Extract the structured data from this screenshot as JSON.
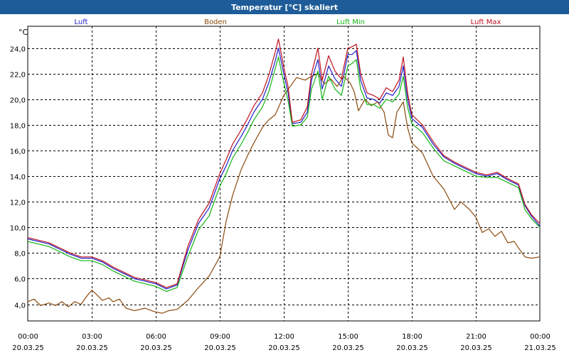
{
  "window": {
    "title": "Temperatur [°C] skaliert"
  },
  "chart_data": {
    "type": "line",
    "ylabel": "°C",
    "ylim": [
      2.7,
      25.7
    ],
    "yticks": [
      4.0,
      6.0,
      8.0,
      10.0,
      12.0,
      14.0,
      16.0,
      18.0,
      20.0,
      22.0,
      24.0
    ],
    "ytick_labels": [
      "4,0",
      "6,0",
      "8,0",
      "10,0",
      "12,0",
      "14,0",
      "16,0",
      "18,0",
      "20,0",
      "22,0",
      "24,0"
    ],
    "xlim": [
      0,
      24
    ],
    "xticks": [
      {
        "x": 0,
        "time": "00:00",
        "date": "20.03.25"
      },
      {
        "x": 3,
        "time": "03:00",
        "date": "20.03.25"
      },
      {
        "x": 6,
        "time": "06:00",
        "date": "20.03.25"
      },
      {
        "x": 9,
        "time": "09:00",
        "date": "20.03.25"
      },
      {
        "x": 12,
        "time": "12:00",
        "date": "20.03.25"
      },
      {
        "x": 15,
        "time": "15:00",
        "date": "20.03.25"
      },
      {
        "x": 18,
        "time": "18:00",
        "date": "20.03.25"
      },
      {
        "x": 21,
        "time": "21:00",
        "date": "20.03.25"
      },
      {
        "x": 24,
        "time": "00:00",
        "date": "21.03.25"
      }
    ],
    "grid": true,
    "legend_position": "top",
    "series": [
      {
        "name": "Luft",
        "color": "#1e1ecc",
        "points": [
          [
            0,
            9.1
          ],
          [
            0.5,
            8.9
          ],
          [
            1,
            8.7
          ],
          [
            1.5,
            8.3
          ],
          [
            2,
            7.9
          ],
          [
            2.5,
            7.6
          ],
          [
            3,
            7.6
          ],
          [
            3.5,
            7.3
          ],
          [
            4,
            6.8
          ],
          [
            4.5,
            6.4
          ],
          [
            5,
            6.0
          ],
          [
            5.5,
            5.8
          ],
          [
            6,
            5.6
          ],
          [
            6.5,
            5.2
          ],
          [
            7,
            5.5
          ],
          [
            7.5,
            8.2
          ],
          [
            8,
            10.3
          ],
          [
            8.5,
            11.5
          ],
          [
            9,
            13.8
          ],
          [
            9.3,
            14.8
          ],
          [
            9.6,
            16.0
          ],
          [
            10,
            17.1
          ],
          [
            10.3,
            18.0
          ],
          [
            10.6,
            19.0
          ],
          [
            11,
            20.0
          ],
          [
            11.3,
            21.3
          ],
          [
            11.6,
            23.0
          ],
          [
            11.75,
            24.0
          ],
          [
            12,
            22.0
          ],
          [
            12.2,
            20.5
          ],
          [
            12.4,
            18.1
          ],
          [
            12.8,
            18.2
          ],
          [
            13.1,
            19.0
          ],
          [
            13.3,
            21.5
          ],
          [
            13.6,
            23.1
          ],
          [
            13.8,
            20.8
          ],
          [
            14.1,
            22.6
          ],
          [
            14.4,
            21.6
          ],
          [
            14.7,
            21.0
          ],
          [
            15,
            23.5
          ],
          [
            15.2,
            23.5
          ],
          [
            15.4,
            23.8
          ],
          [
            15.6,
            21.5
          ],
          [
            15.9,
            20.1
          ],
          [
            16.2,
            20.0
          ],
          [
            16.5,
            19.7
          ],
          [
            16.8,
            20.5
          ],
          [
            17.1,
            20.3
          ],
          [
            17.4,
            21.0
          ],
          [
            17.6,
            22.6
          ],
          [
            17.8,
            20.0
          ],
          [
            18,
            18.5
          ],
          [
            18.5,
            17.8
          ],
          [
            19,
            16.5
          ],
          [
            19.5,
            15.5
          ],
          [
            20,
            15.0
          ],
          [
            20.5,
            14.6
          ],
          [
            21,
            14.2
          ],
          [
            21.5,
            14.0
          ],
          [
            22,
            14.2
          ],
          [
            22.5,
            13.7
          ],
          [
            23,
            13.3
          ],
          [
            23.3,
            11.7
          ],
          [
            23.6,
            10.9
          ],
          [
            24,
            10.1
          ]
        ]
      },
      {
        "name": "Boden",
        "color": "#8b4a0e",
        "points": [
          [
            0,
            4.2
          ],
          [
            0.3,
            4.4
          ],
          [
            0.6,
            3.9
          ],
          [
            1,
            4.1
          ],
          [
            1.3,
            3.9
          ],
          [
            1.6,
            4.2
          ],
          [
            1.9,
            3.8
          ],
          [
            2.2,
            4.2
          ],
          [
            2.5,
            4.0
          ],
          [
            2.8,
            4.7
          ],
          [
            3,
            5.1
          ],
          [
            3.2,
            4.8
          ],
          [
            3.5,
            4.3
          ],
          [
            3.8,
            4.5
          ],
          [
            4,
            4.2
          ],
          [
            4.3,
            4.4
          ],
          [
            4.6,
            3.7
          ],
          [
            5,
            3.5
          ],
          [
            5.5,
            3.7
          ],
          [
            5.8,
            3.5
          ],
          [
            6,
            3.4
          ],
          [
            6.3,
            3.3
          ],
          [
            6.6,
            3.5
          ],
          [
            7,
            3.6
          ],
          [
            7.5,
            4.3
          ],
          [
            8,
            5.3
          ],
          [
            8.5,
            6.2
          ],
          [
            9,
            7.7
          ],
          [
            9.3,
            10.5
          ],
          [
            9.6,
            12.5
          ],
          [
            10,
            14.5
          ],
          [
            10.3,
            15.6
          ],
          [
            10.6,
            16.6
          ],
          [
            11,
            17.8
          ],
          [
            11.3,
            18.4
          ],
          [
            11.6,
            18.8
          ],
          [
            12,
            20.3
          ],
          [
            12.3,
            21.0
          ],
          [
            12.6,
            21.7
          ],
          [
            13,
            21.5
          ],
          [
            13.3,
            21.8
          ],
          [
            13.6,
            22.0
          ],
          [
            13.9,
            21.2
          ],
          [
            14.2,
            21.6
          ],
          [
            14.5,
            21.0
          ],
          [
            14.8,
            21.8
          ],
          [
            15.1,
            21.3
          ],
          [
            15.3,
            20.6
          ],
          [
            15.5,
            19.1
          ],
          [
            15.8,
            20.0
          ],
          [
            16.1,
            19.5
          ],
          [
            16.4,
            19.8
          ],
          [
            16.7,
            19.0
          ],
          [
            16.9,
            17.2
          ],
          [
            17.1,
            17.0
          ],
          [
            17.3,
            19.0
          ],
          [
            17.6,
            19.8
          ],
          [
            17.8,
            17.8
          ],
          [
            18,
            16.6
          ],
          [
            18.5,
            15.8
          ],
          [
            19,
            14.0
          ],
          [
            19.5,
            13.0
          ],
          [
            20,
            11.4
          ],
          [
            20.3,
            12.0
          ],
          [
            20.7,
            11.4
          ],
          [
            21,
            10.8
          ],
          [
            21.3,
            9.6
          ],
          [
            21.6,
            9.9
          ],
          [
            21.9,
            9.3
          ],
          [
            22.2,
            9.7
          ],
          [
            22.5,
            8.8
          ],
          [
            22.8,
            8.9
          ],
          [
            23,
            8.4
          ],
          [
            23.3,
            7.7
          ],
          [
            23.6,
            7.6
          ],
          [
            24,
            7.7
          ]
        ]
      },
      {
        "name": "Luft Min",
        "color": "#14b414",
        "points": [
          [
            0,
            8.9
          ],
          [
            0.5,
            8.7
          ],
          [
            1,
            8.5
          ],
          [
            1.5,
            8.1
          ],
          [
            2,
            7.7
          ],
          [
            2.5,
            7.4
          ],
          [
            3,
            7.4
          ],
          [
            3.5,
            7.1
          ],
          [
            4,
            6.6
          ],
          [
            4.5,
            6.2
          ],
          [
            5,
            5.8
          ],
          [
            5.5,
            5.6
          ],
          [
            6,
            5.4
          ],
          [
            6.5,
            5.0
          ],
          [
            7,
            5.3
          ],
          [
            7.5,
            7.7
          ],
          [
            8,
            9.8
          ],
          [
            8.5,
            10.9
          ],
          [
            9,
            13.2
          ],
          [
            9.3,
            14.2
          ],
          [
            9.6,
            15.4
          ],
          [
            10,
            16.5
          ],
          [
            10.3,
            17.4
          ],
          [
            10.6,
            18.4
          ],
          [
            11,
            19.4
          ],
          [
            11.3,
            20.6
          ],
          [
            11.6,
            22.4
          ],
          [
            11.75,
            23.3
          ],
          [
            12,
            21.3
          ],
          [
            12.2,
            19.9
          ],
          [
            12.4,
            17.9
          ],
          [
            12.8,
            18.0
          ],
          [
            13.1,
            18.6
          ],
          [
            13.3,
            20.8
          ],
          [
            13.6,
            22.2
          ],
          [
            13.8,
            20.0
          ],
          [
            14.1,
            21.8
          ],
          [
            14.4,
            20.8
          ],
          [
            14.7,
            20.3
          ],
          [
            15,
            22.6
          ],
          [
            15.2,
            22.8
          ],
          [
            15.4,
            23.1
          ],
          [
            15.6,
            20.8
          ],
          [
            15.9,
            19.6
          ],
          [
            16.2,
            19.6
          ],
          [
            16.5,
            19.3
          ],
          [
            16.8,
            20.0
          ],
          [
            17.1,
            19.8
          ],
          [
            17.4,
            20.4
          ],
          [
            17.6,
            21.8
          ],
          [
            17.8,
            19.4
          ],
          [
            18,
            18.1
          ],
          [
            18.5,
            17.4
          ],
          [
            19,
            16.2
          ],
          [
            19.5,
            15.2
          ],
          [
            20,
            14.8
          ],
          [
            20.5,
            14.4
          ],
          [
            21,
            14.0
          ],
          [
            21.5,
            13.9
          ],
          [
            22,
            13.9
          ],
          [
            22.5,
            13.5
          ],
          [
            23,
            13.1
          ],
          [
            23.3,
            11.4
          ],
          [
            23.6,
            10.7
          ],
          [
            24,
            10.0
          ]
        ]
      },
      {
        "name": "Luft Max",
        "color": "#c0101e",
        "points": [
          [
            0,
            9.2
          ],
          [
            0.5,
            9.0
          ],
          [
            1,
            8.8
          ],
          [
            1.5,
            8.4
          ],
          [
            2,
            8.0
          ],
          [
            2.5,
            7.7
          ],
          [
            3,
            7.7
          ],
          [
            3.5,
            7.4
          ],
          [
            4,
            6.9
          ],
          [
            4.5,
            6.5
          ],
          [
            5,
            6.1
          ],
          [
            5.5,
            5.9
          ],
          [
            6,
            5.7
          ],
          [
            6.5,
            5.3
          ],
          [
            7,
            5.6
          ],
          [
            7.5,
            8.5
          ],
          [
            8,
            10.6
          ],
          [
            8.5,
            11.9
          ],
          [
            9,
            14.2
          ],
          [
            9.3,
            15.3
          ],
          [
            9.6,
            16.5
          ],
          [
            10,
            17.6
          ],
          [
            10.3,
            18.5
          ],
          [
            10.6,
            19.5
          ],
          [
            11,
            20.5
          ],
          [
            11.3,
            21.9
          ],
          [
            11.6,
            23.7
          ],
          [
            11.75,
            24.7
          ],
          [
            12,
            22.5
          ],
          [
            12.2,
            21.0
          ],
          [
            12.4,
            18.2
          ],
          [
            12.8,
            18.4
          ],
          [
            13.1,
            19.4
          ],
          [
            13.3,
            22.0
          ],
          [
            13.6,
            24.0
          ],
          [
            13.8,
            21.5
          ],
          [
            14.1,
            23.4
          ],
          [
            14.4,
            22.2
          ],
          [
            14.7,
            21.6
          ],
          [
            15,
            24.0
          ],
          [
            15.2,
            24.1
          ],
          [
            15.4,
            24.3
          ],
          [
            15.6,
            22.0
          ],
          [
            15.9,
            20.5
          ],
          [
            16.2,
            20.3
          ],
          [
            16.5,
            20.0
          ],
          [
            16.8,
            20.9
          ],
          [
            17.1,
            20.6
          ],
          [
            17.4,
            21.5
          ],
          [
            17.6,
            23.3
          ],
          [
            17.8,
            20.5
          ],
          [
            18,
            18.8
          ],
          [
            18.5,
            18.0
          ],
          [
            19,
            16.7
          ],
          [
            19.5,
            15.6
          ],
          [
            20,
            15.1
          ],
          [
            20.5,
            14.7
          ],
          [
            21,
            14.3
          ],
          [
            21.5,
            14.1
          ],
          [
            22,
            14.3
          ],
          [
            22.5,
            13.8
          ],
          [
            23,
            13.4
          ],
          [
            23.3,
            11.8
          ],
          [
            23.6,
            11.0
          ],
          [
            24,
            10.3
          ]
        ]
      }
    ]
  }
}
